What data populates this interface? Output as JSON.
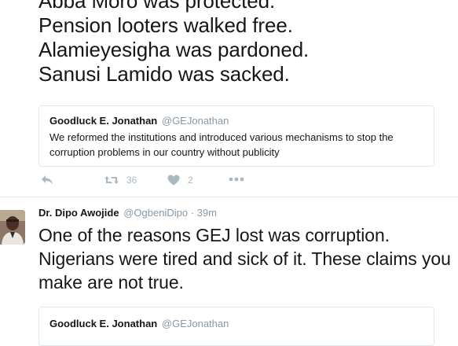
{
  "tweet1": {
    "lines": [
      "Abba Moro was protected.",
      "Pension looters walked free.",
      "Alamieyesigha was pardoned.",
      "Sanusi Lamido was sacked."
    ],
    "quote": {
      "name": "Goodluck E. Jonathan",
      "handle": "@GEJonathan",
      "text": "We reformed the institutions and introduced various mechanisms to stop the corruption problems in our country without publicity"
    },
    "actions": {
      "retweet_count": "36",
      "like_count": "2",
      "icons": [
        "reply-icon",
        "retweet-icon",
        "heart-icon",
        "more-icon"
      ],
      "icon_color": "#aab8c2"
    }
  },
  "tweet2": {
    "name": "Dr. Dipo Awojide",
    "handle": "@OgbeniDipo",
    "separator": "·",
    "time": "39m",
    "text": "One of the reasons GEJ lost was corruption. Nigerians were tired and sick of it. These claims you make are not true.",
    "quote": {
      "name": "Goodluck E. Jonathan",
      "handle": "@GEJonathan"
    }
  },
  "colors": {
    "text": "#14171a",
    "muted": "#8899a6",
    "border": "#e1e8ed"
  }
}
